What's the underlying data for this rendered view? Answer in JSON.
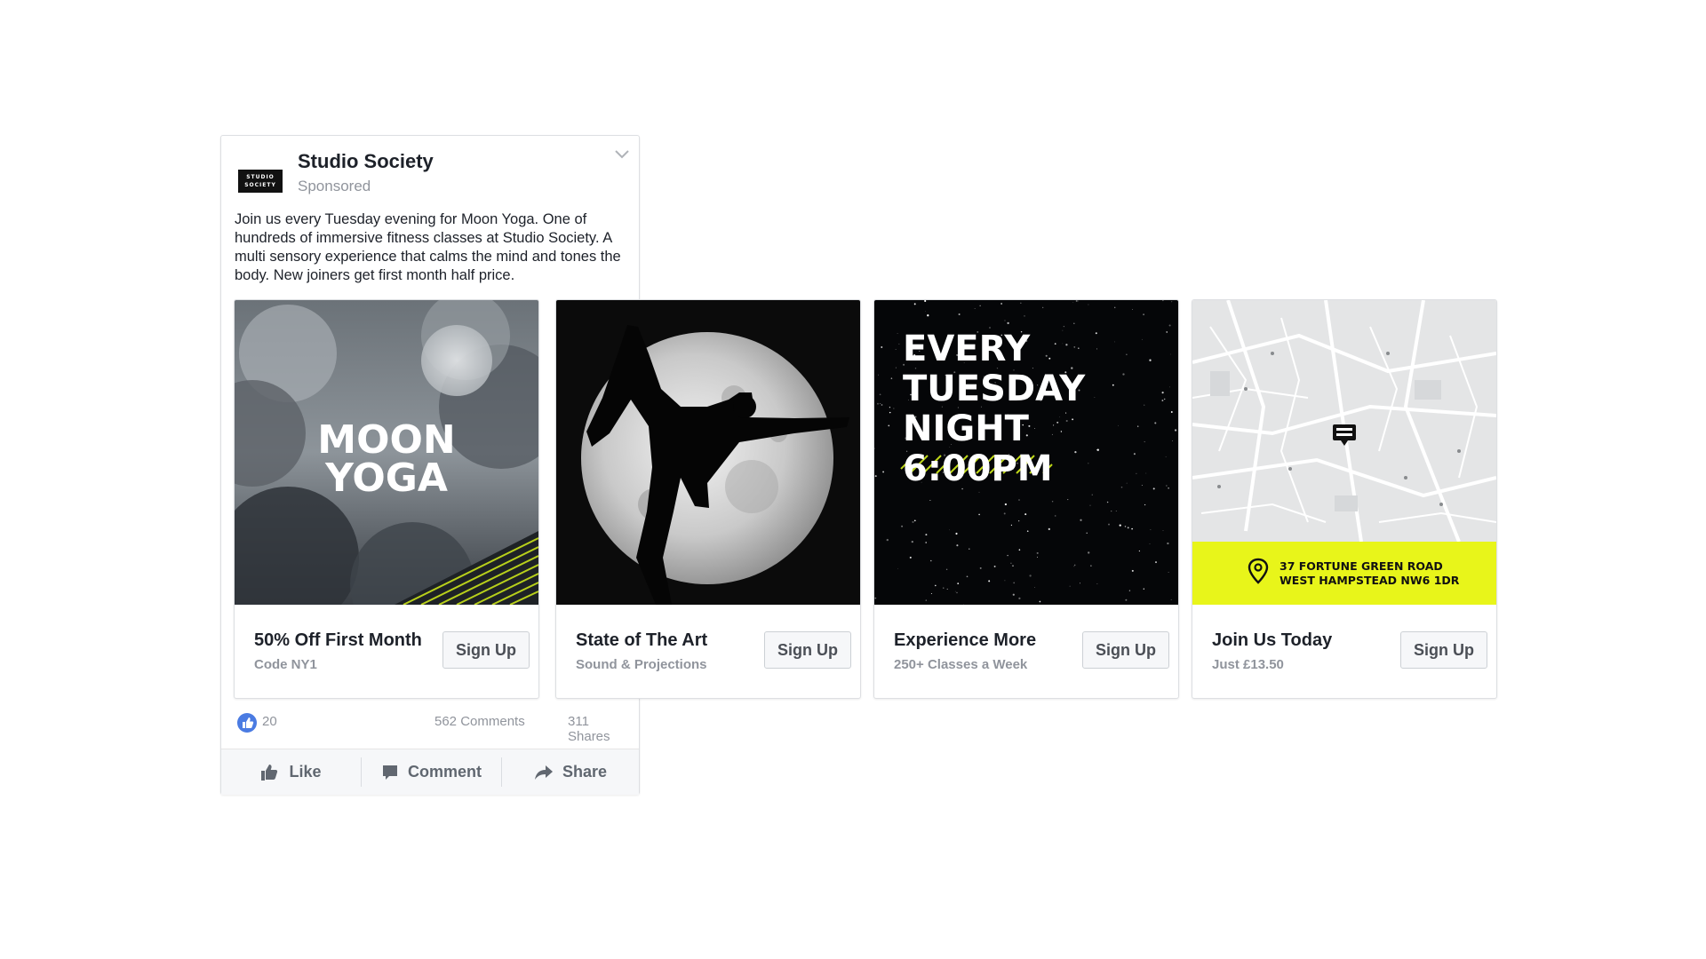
{
  "post": {
    "page_name": "Studio Society",
    "logo_lines": [
      "STUDIO",
      "SOCIETY"
    ],
    "sponsored_label": "Sponsored",
    "menu_icon": "chevron-down-icon",
    "body_text": "Join us every Tuesday evening for Moon Yoga. One of hundreds of immersive fitness classes at Studio Society. A multi sensory experience that calms the mind and tones the body. New joiners get first month half price."
  },
  "cards": [
    {
      "image_text": [
        "MOON",
        "YOGA"
      ],
      "title": "50% Off First Month",
      "subtitle": "Code NY1",
      "cta_label": "Sign Up"
    },
    {
      "image_alt": "yoga-silhouette-full-moon",
      "title": "State of The Art",
      "subtitle": "Sound & Projections",
      "cta_label": "Sign Up"
    },
    {
      "image_text": [
        "EVERY",
        "TUESDAY",
        "NIGHT",
        "6:00PM"
      ],
      "title": "Experience More",
      "subtitle": "250+ Classes a Week",
      "cta_label": "Sign Up"
    },
    {
      "address_lines": [
        "37 FORTUNE GREEN ROAD",
        "WEST HAMPSTEAD NW6 1DR"
      ],
      "title": "Join Us Today",
      "subtitle": "Just £13.50",
      "cta_label": "Sign Up"
    }
  ],
  "reactions": {
    "like_count": "20",
    "comments": "562 Comments",
    "shares": "311 Shares"
  },
  "actions": {
    "like": "Like",
    "comment": "Comment",
    "share": "Share"
  },
  "colors": {
    "accent_yellow": "#e8f51a",
    "facebook_blue": "#4a7be2"
  }
}
